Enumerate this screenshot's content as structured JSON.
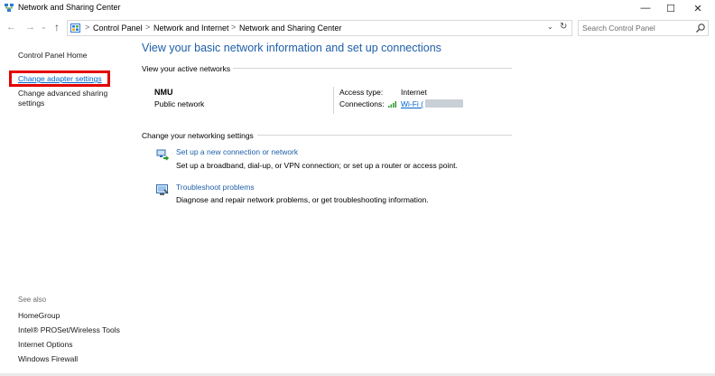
{
  "window": {
    "title": "Network and Sharing Center",
    "minimize_glyph": "—",
    "maximize_glyph": "☐",
    "close_glyph": "✕"
  },
  "nav": {
    "back_glyph": "←",
    "forward_glyph": "→",
    "recent_glyph": "⌄",
    "up_glyph": "↑",
    "breadcrumbs": [
      "Control Panel",
      "Network and Internet",
      "Network and Sharing Center"
    ],
    "separator": ">",
    "dropdown_glyph": "⌄",
    "refresh_glyph": "↻",
    "search_placeholder": "Search Control Panel"
  },
  "sidebar": {
    "home": "Control Panel Home",
    "change_adapter": "Change adapter settings",
    "change_sharing_line1": "Change advanced sharing",
    "change_sharing_line2": "settings",
    "see_also_label": "See also",
    "see_also": [
      "HomeGroup",
      "Intel® PROSet/Wireless Tools",
      "Internet Options",
      "Windows Firewall"
    ]
  },
  "main": {
    "title": "View your basic network information and set up connections",
    "active_networks_label": "View your active networks",
    "network": {
      "name": "NMU",
      "category": "Public network",
      "access_type_label": "Access type:",
      "access_type_value": "Internet",
      "connections_label": "Connections:",
      "connection_name": "Wi-Fi ("
    },
    "settings_label": "Change your networking settings",
    "tasks": [
      {
        "link": "Set up a new connection or network",
        "description": "Set up a broadband, dial-up, or VPN connection; or set up a router or access point."
      },
      {
        "link": "Troubleshoot problems",
        "description": "Diagnose and repair network problems, or get troubleshooting information."
      }
    ]
  },
  "colors": {
    "accent": "#1e5fa8",
    "link": "#0066cc",
    "highlight": "#e30000"
  }
}
